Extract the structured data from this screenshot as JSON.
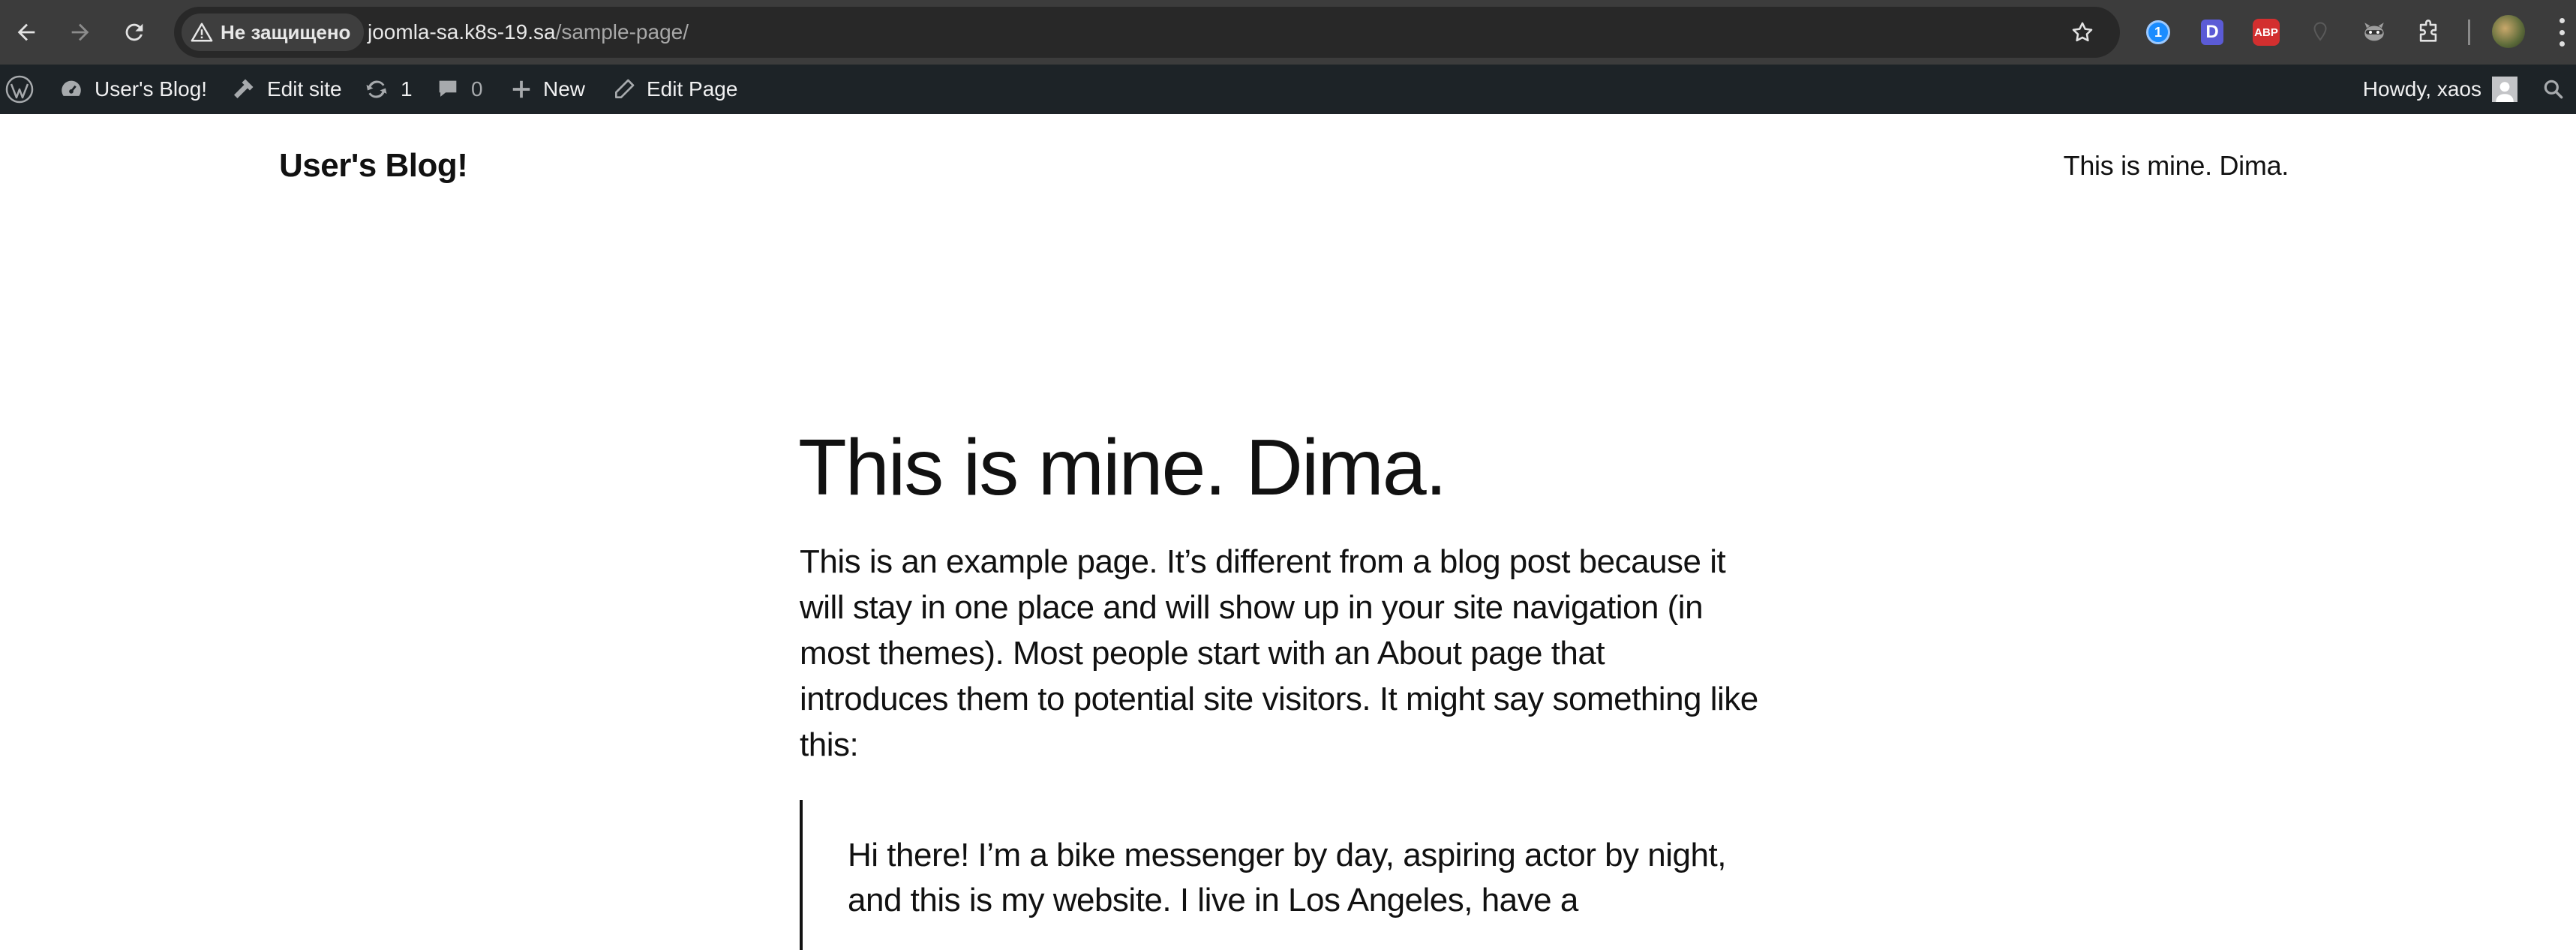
{
  "browser": {
    "security_label": "Не защищено",
    "url_host": "joomla-sa.k8s-19.sa",
    "url_path": "/sample-page/",
    "extensions": {
      "abp_label": "ABP",
      "d_label": "D",
      "onepass_label": "1"
    }
  },
  "adminbar": {
    "site_name": "User's Blog!",
    "edit_site": "Edit site",
    "updates_count": "1",
    "comments_count": "0",
    "new_label": "New",
    "edit_page": "Edit Page",
    "howdy": "Howdy, xaos"
  },
  "site": {
    "title": "User's Blog!",
    "nav_link": "This is mine. Dima."
  },
  "page": {
    "title": "This is mine. Dima.",
    "intro": "This is an example page. It’s different from a blog post because it will stay in one place and will show up in your site navigation (in most themes). Most people start with an About page that introduces them to potential site visitors. It might say something like this:",
    "quote": "Hi there! I’m a bike messenger by day, aspiring actor by night, and this is my website. I live in Los Angeles, have a"
  }
}
